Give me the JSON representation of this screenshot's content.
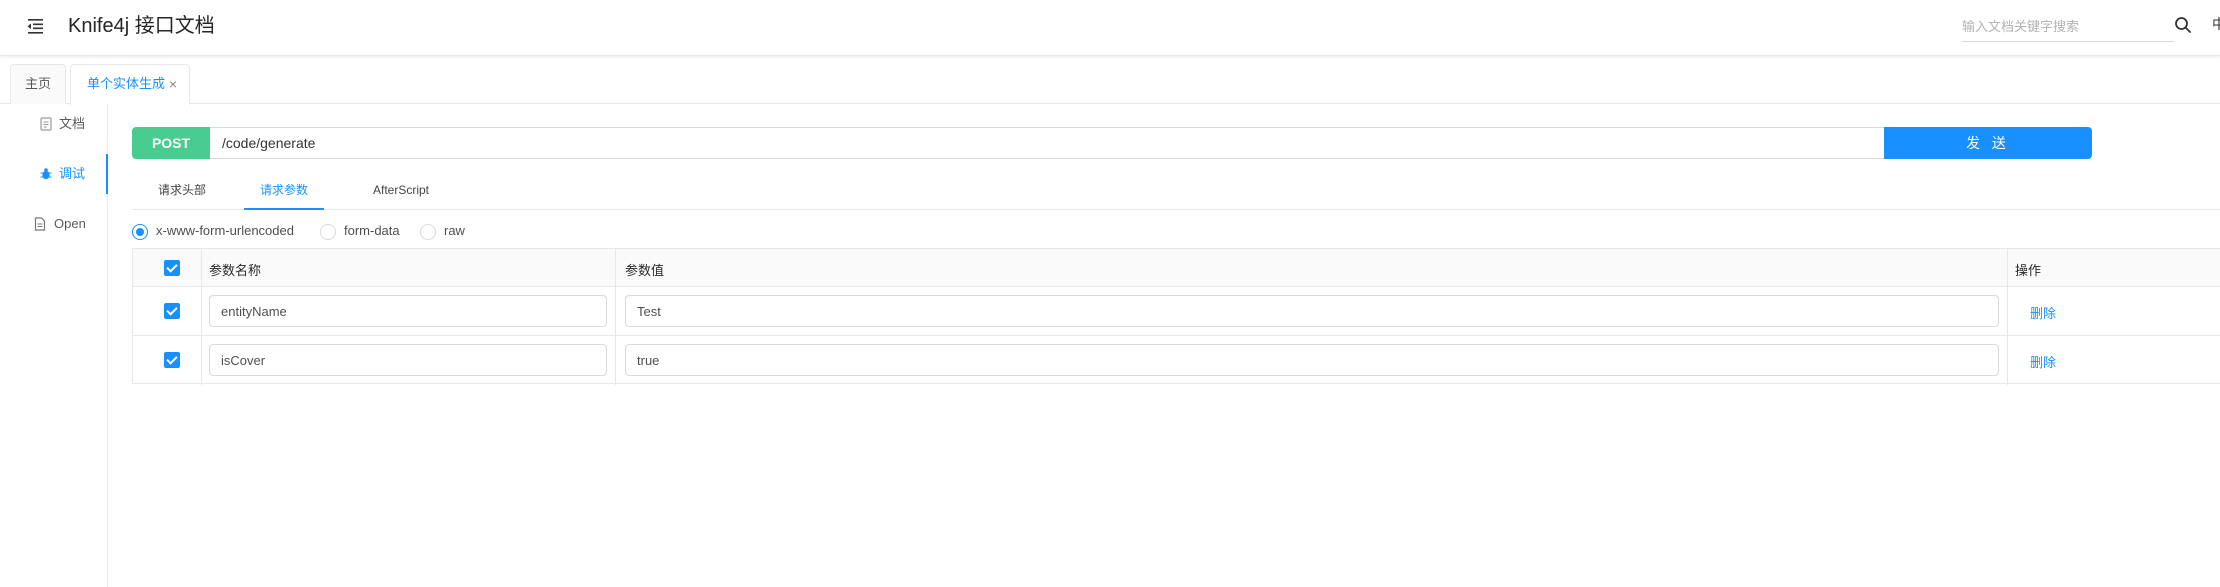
{
  "header": {
    "title": "Knife4j 接口文档",
    "search_placeholder": "输入文档关键字搜索",
    "lang_label": "中"
  },
  "tabs": [
    {
      "label": "主页"
    },
    {
      "label": "单个实体生成",
      "close": "×"
    }
  ],
  "sidebar": {
    "items": [
      {
        "label": "文档",
        "icon": "document-icon"
      },
      {
        "label": "调试",
        "icon": "bug-icon"
      },
      {
        "label": "Open",
        "icon": "file-icon"
      }
    ]
  },
  "request": {
    "method": "POST",
    "url": "/code/generate",
    "send_label": "发 送"
  },
  "sub_tabs": [
    {
      "label": "请求头部"
    },
    {
      "label": "请求参数"
    },
    {
      "label": "AfterScript"
    }
  ],
  "body_types": [
    {
      "label": "x-www-form-urlencoded",
      "checked": true
    },
    {
      "label": "form-data",
      "checked": false
    },
    {
      "label": "raw",
      "checked": false
    }
  ],
  "params_table": {
    "headers": {
      "name": "参数名称",
      "value": "参数值",
      "action": "操作"
    },
    "rows": [
      {
        "name": "entityName",
        "value": "Test",
        "action": "删除",
        "checked": true
      },
      {
        "name": "isCover",
        "value": "true",
        "action": "删除",
        "checked": true
      }
    ]
  },
  "colors": {
    "primary": "#1890ff",
    "post_method": "#49cc90"
  }
}
